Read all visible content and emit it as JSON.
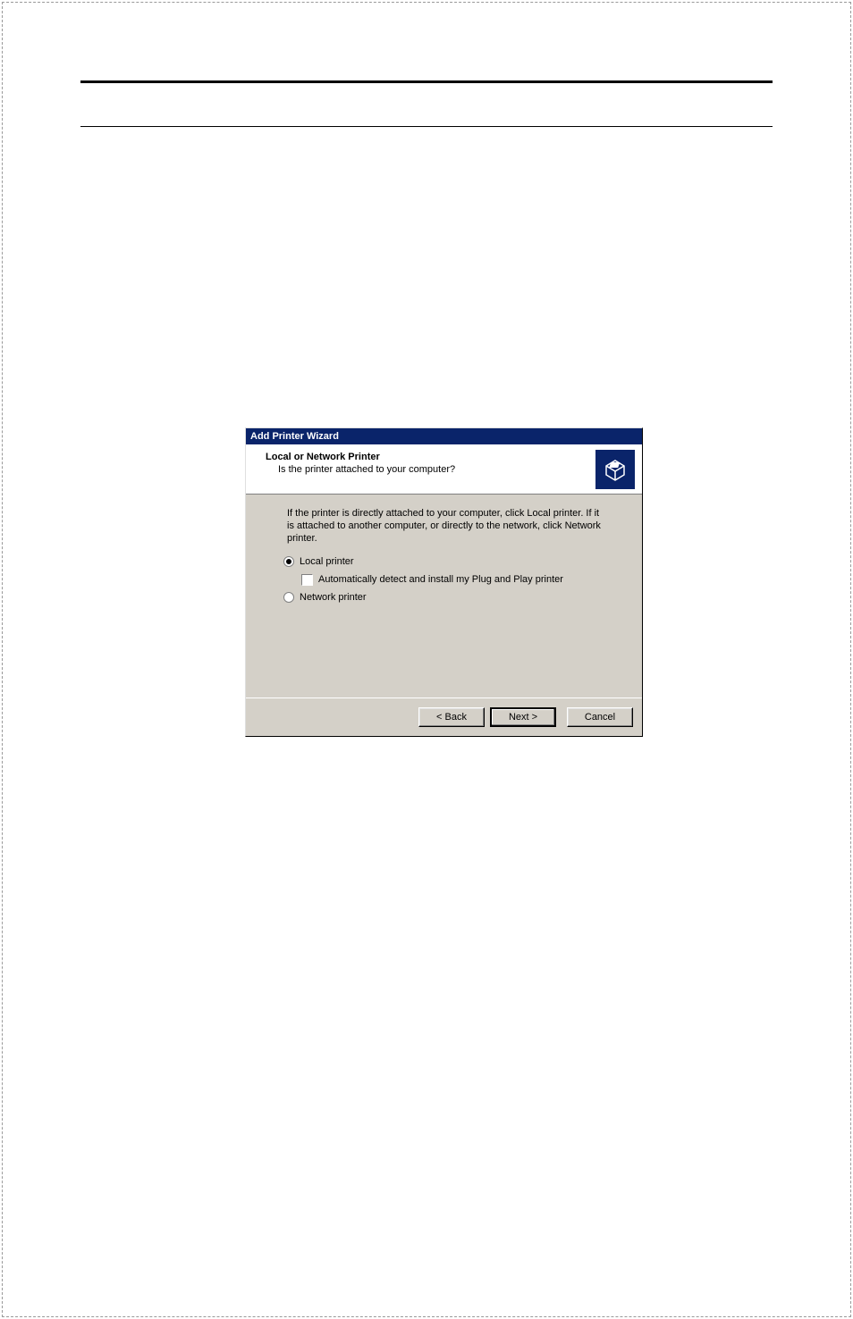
{
  "dialog": {
    "title": "Add Printer Wizard",
    "header": {
      "title": "Local or Network Printer",
      "subtitle": "Is the printer attached to your computer?"
    },
    "body": {
      "instruction": "If the printer is directly attached to your computer, click Local printer. If it is attached to another computer, or directly to the network, click Network printer.",
      "option_local": "Local printer",
      "option_autodetect": "Automatically detect and install my Plug and Play printer",
      "option_network": "Network printer",
      "selected": "local",
      "autodetect_checked": false
    },
    "footer": {
      "back": "< Back",
      "next": "Next >",
      "cancel": "Cancel"
    }
  }
}
